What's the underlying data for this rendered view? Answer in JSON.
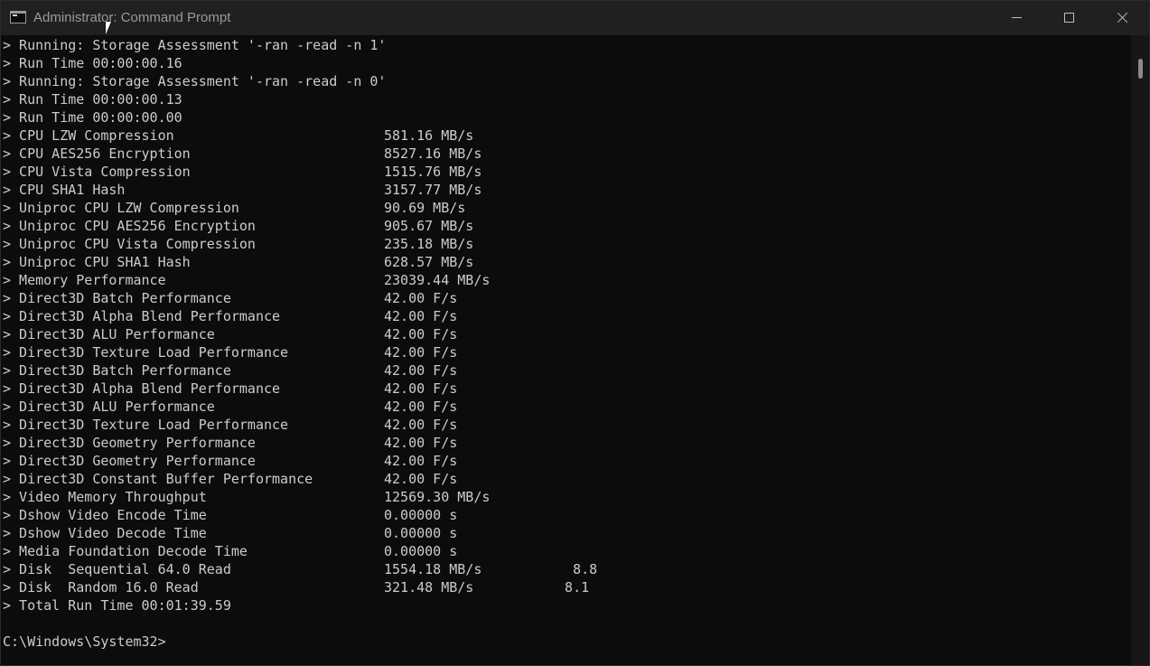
{
  "window": {
    "title": "Administrator: Command Prompt"
  },
  "console": {
    "lines": [
      {
        "c1": "> Running: Storage Assessment '-ran -read -n 1'",
        "c2": "",
        "c3": ""
      },
      {
        "c1": "> Run Time 00:00:00.16",
        "c2": "",
        "c3": ""
      },
      {
        "c1": "> Running: Storage Assessment '-ran -read -n 0'",
        "c2": "",
        "c3": ""
      },
      {
        "c1": "> Run Time 00:00:00.13",
        "c2": "",
        "c3": ""
      },
      {
        "c1": "> Run Time 00:00:00.00",
        "c2": "",
        "c3": ""
      },
      {
        "c1": "> CPU LZW Compression",
        "c2": "581.16 MB/s",
        "c3": ""
      },
      {
        "c1": "> CPU AES256 Encryption",
        "c2": "8527.16 MB/s",
        "c3": ""
      },
      {
        "c1": "> CPU Vista Compression",
        "c2": "1515.76 MB/s",
        "c3": ""
      },
      {
        "c1": "> CPU SHA1 Hash",
        "c2": "3157.77 MB/s",
        "c3": ""
      },
      {
        "c1": "> Uniproc CPU LZW Compression",
        "c2": "90.69 MB/s",
        "c3": ""
      },
      {
        "c1": "> Uniproc CPU AES256 Encryption",
        "c2": "905.67 MB/s",
        "c3": ""
      },
      {
        "c1": "> Uniproc CPU Vista Compression",
        "c2": "235.18 MB/s",
        "c3": ""
      },
      {
        "c1": "> Uniproc CPU SHA1 Hash",
        "c2": "628.57 MB/s",
        "c3": ""
      },
      {
        "c1": "> Memory Performance",
        "c2": "23039.44 MB/s",
        "c3": ""
      },
      {
        "c1": "> Direct3D Batch Performance",
        "c2": "42.00 F/s",
        "c3": ""
      },
      {
        "c1": "> Direct3D Alpha Blend Performance",
        "c2": "42.00 F/s",
        "c3": ""
      },
      {
        "c1": "> Direct3D ALU Performance",
        "c2": "42.00 F/s",
        "c3": ""
      },
      {
        "c1": "> Direct3D Texture Load Performance",
        "c2": "42.00 F/s",
        "c3": ""
      },
      {
        "c1": "> Direct3D Batch Performance",
        "c2": "42.00 F/s",
        "c3": ""
      },
      {
        "c1": "> Direct3D Alpha Blend Performance",
        "c2": "42.00 F/s",
        "c3": ""
      },
      {
        "c1": "> Direct3D ALU Performance",
        "c2": "42.00 F/s",
        "c3": ""
      },
      {
        "c1": "> Direct3D Texture Load Performance",
        "c2": "42.00 F/s",
        "c3": ""
      },
      {
        "c1": "> Direct3D Geometry Performance",
        "c2": "42.00 F/s",
        "c3": ""
      },
      {
        "c1": "> Direct3D Geometry Performance",
        "c2": "42.00 F/s",
        "c3": ""
      },
      {
        "c1": "> Direct3D Constant Buffer Performance",
        "c2": "42.00 F/s",
        "c3": ""
      },
      {
        "c1": "> Video Memory Throughput",
        "c2": "12569.30 MB/s",
        "c3": ""
      },
      {
        "c1": "> Dshow Video Encode Time",
        "c2": "0.00000 s",
        "c3": ""
      },
      {
        "c1": "> Dshow Video Decode Time",
        "c2": "0.00000 s",
        "c3": ""
      },
      {
        "c1": "> Media Foundation Decode Time",
        "c2": "0.00000 s",
        "c3": ""
      },
      {
        "c1": "> Disk  Sequential 64.0 Read",
        "c2": "1554.18 MB/s",
        "c3": "   8.8"
      },
      {
        "c1": "> Disk  Random 16.0 Read",
        "c2": "321.48 MB/s",
        "c3": "  8.1"
      },
      {
        "c1": "> Total Run Time 00:01:39.59",
        "c2": "",
        "c3": ""
      }
    ],
    "prompt": "C:\\Windows\\System32>"
  }
}
